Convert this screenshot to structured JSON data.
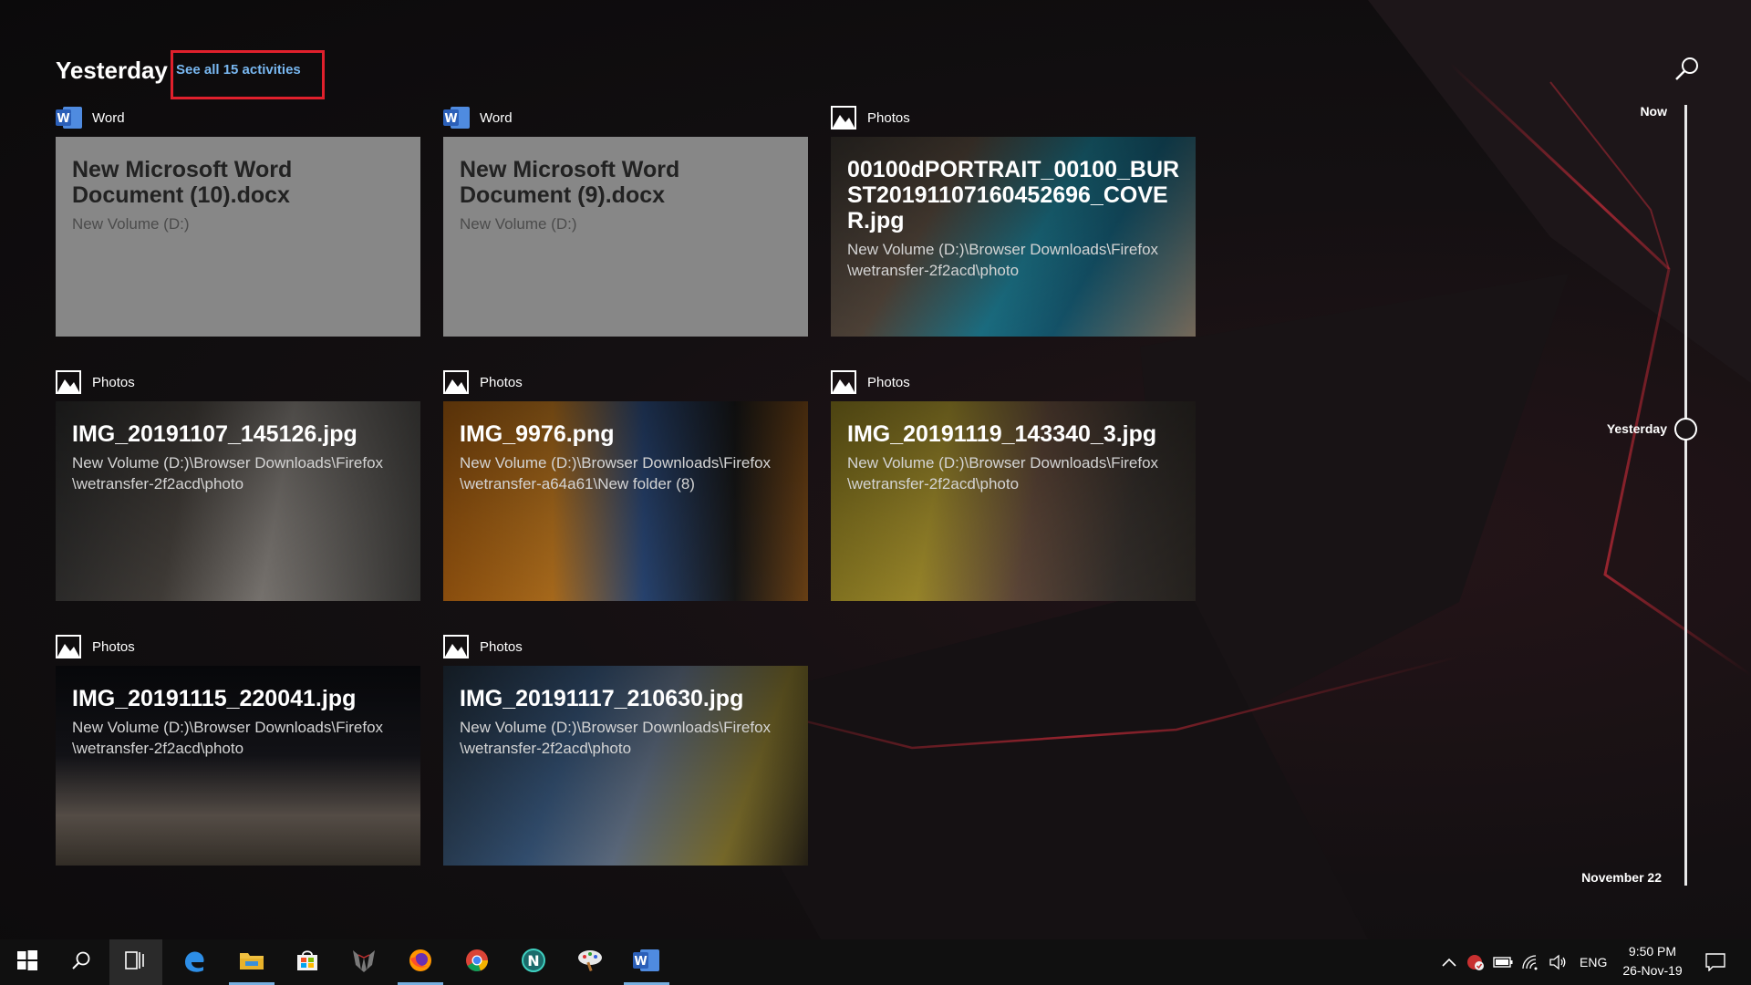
{
  "section": {
    "title": "Yesterday",
    "see_all": "See all 15 activities"
  },
  "colors": {
    "accent_link": "#78b7f0",
    "highlight": "#e0202c",
    "word_blue": "#2b5fb8"
  },
  "cards": [
    {
      "app": "Word",
      "icon": "word-icon",
      "title": "New Microsoft Word Document (10).docx",
      "path": "New Volume (D:)"
    },
    {
      "app": "Word",
      "icon": "word-icon",
      "title": "New Microsoft Word Document (9).docx",
      "path": "New Volume (D:)"
    },
    {
      "app": "Photos",
      "icon": "photos-icon",
      "title": "00100dPORTRAIT_00100_BURST20191107160452696_COVER.jpg",
      "path": "New Volume (D:)\\Browser Downloads\\Firefox\n\\wetransfer-2f2acd\\photo"
    },
    {
      "app": "Photos",
      "icon": "photos-icon",
      "title": "IMG_20191107_145126.jpg",
      "path": "New Volume (D:)\\Browser Downloads\\Firefox\n\\wetransfer-2f2acd\\photo"
    },
    {
      "app": "Photos",
      "icon": "photos-icon",
      "title": "IMG_9976.png",
      "path": "New Volume (D:)\\Browser Downloads\\Firefox\n\\wetransfer-a64a61\\New folder (8)"
    },
    {
      "app": "Photos",
      "icon": "photos-icon",
      "title": "IMG_20191119_143340_3.jpg",
      "path": "New Volume (D:)\\Browser Downloads\\Firefox\n\\wetransfer-2f2acd\\photo"
    },
    {
      "app": "Photos",
      "icon": "photos-icon",
      "title": "IMG_20191115_220041.jpg",
      "path": "New Volume (D:)\\Browser Downloads\\Firefox\n\\wetransfer-2f2acd\\photo"
    },
    {
      "app": "Photos",
      "icon": "photos-icon",
      "title": "IMG_20191117_210630.jpg",
      "path": "New Volume (D:)\\Browser Downloads\\Firefox\n\\wetransfer-2f2acd\\photo"
    }
  ],
  "timeline": {
    "now": "Now",
    "yesterday": "Yesterday",
    "bottom": "November 22"
  },
  "taskbar": {
    "apps": [
      "windows-start-icon",
      "search-icon",
      "task-view-icon",
      "edge-icon",
      "file-explorer-icon",
      "store-icon",
      "predator-icon",
      "firefox-icon",
      "chrome-icon",
      "n-app-icon",
      "paint-icon",
      "word-icon"
    ],
    "tray": {
      "language": "ENG",
      "time": "9:50 PM",
      "date": "26-Nov-19"
    }
  }
}
